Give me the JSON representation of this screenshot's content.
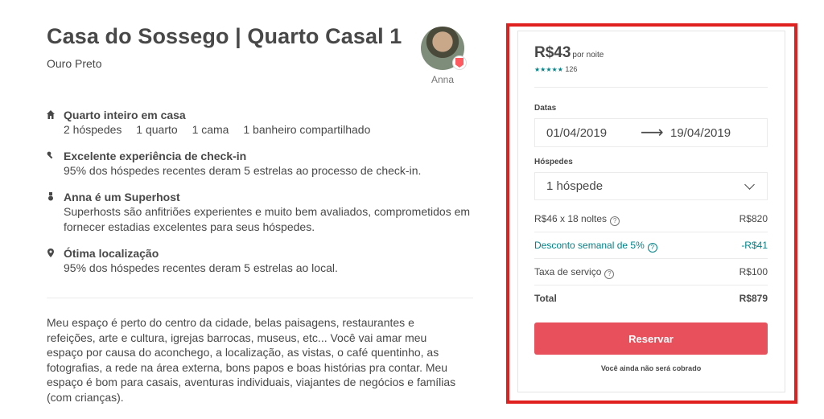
{
  "listing": {
    "title": "Casa do Sossego | Quarto Casal 1",
    "city": "Ouro Preto",
    "host_name": "Anna"
  },
  "features": [
    {
      "icon": "home-icon",
      "title": "Quarto inteiro em casa",
      "details": [
        "2 hóspedes",
        "1 quarto",
        "1 cama",
        "1 banheiro compartilhado"
      ]
    },
    {
      "icon": "key-icon",
      "title": "Excelente experiência de check-in",
      "description": "95% dos hóspedes recentes deram 5 estrelas ao processo de check-in."
    },
    {
      "icon": "medal-icon",
      "title": "Anna é um Superhost",
      "description": "Superhosts são anfitriões experientes e muito bem avaliados, comprometidos em fornecer estadias excelentes para seus hóspedes."
    },
    {
      "icon": "location-pin-icon",
      "title": "Ótima localização",
      "description": "95% dos hóspedes recentes deram 5 estrelas ao local."
    }
  ],
  "description": "Meu espaço é perto do centro da cidade, belas paisagens, restaurantes e refeições, arte e cultura, igrejas barrocas, museus, etc... Você vai amar meu espaço por causa do aconchego, a localização, as vistas, o café quentinho, as fotografias, a rede na área externa, bons papos e boas histórias pra contar. Meu espaço é bom para casais, aventuras individuais, viajantes de negócios e famílias (com crianças).",
  "booking": {
    "price": "R$43",
    "per_night": "por noite",
    "stars": "★★★★★",
    "review_count": "126",
    "dates_label": "Datas",
    "check_in": "01/04/2019",
    "arrow": "⟶",
    "check_out": "19/04/2019",
    "guests_label": "Hóspedes",
    "guests_value": "1 hóspede",
    "lines": {
      "nightly_label": "R$46 x 18 noltes",
      "nightly_value": "R$820",
      "discount_label": "Desconto semanal de 5%",
      "discount_value": "-R$41",
      "service_label": "Taxa de serviço",
      "service_value": "R$100",
      "total_label": "Total",
      "total_value": "R$879"
    },
    "help_glyph": "?",
    "reserve_label": "Reservar",
    "note": "Você ainda não será cobrado"
  },
  "colors": {
    "accent": "#e8505b",
    "teal": "#008489",
    "highlight_frame": "#e0201e",
    "text": "#484848"
  }
}
